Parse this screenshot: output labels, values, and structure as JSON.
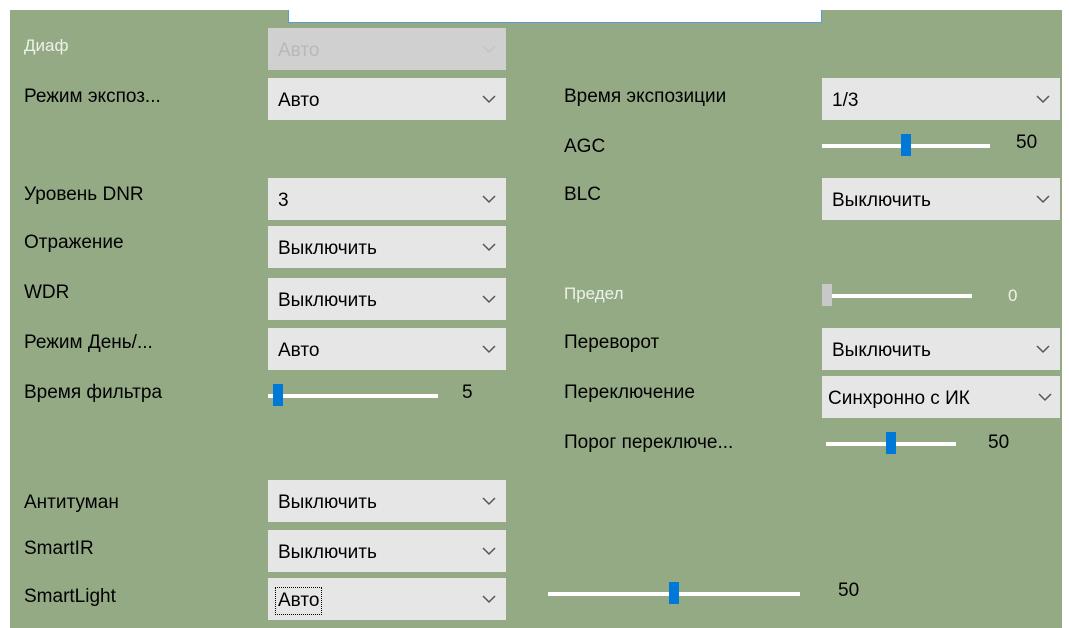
{
  "left": {
    "iris": {
      "label": "Диаф",
      "value": "Авто"
    },
    "exposure_mode": {
      "label": "Режим экспоз...",
      "value": "Авто"
    },
    "dnr_level": {
      "label": "Уровень DNR",
      "value": "3"
    },
    "mirror": {
      "label": "Отражение",
      "value": "Выключить"
    },
    "wdr": {
      "label": "WDR",
      "value": "Выключить"
    },
    "day_night": {
      "label": "Режим День/...",
      "value": "Авто"
    },
    "filter_time": {
      "label": "Время фильтра",
      "value": "5",
      "level": 0.03
    },
    "defog": {
      "label": "Антитуман",
      "value": "Выключить"
    },
    "smartir": {
      "label": "SmartIR",
      "value": "Выключить"
    },
    "smartlight": {
      "label": "SmartLight",
      "value": "Авто"
    },
    "smartlight_slider": {
      "value": "50",
      "level": 0.5
    }
  },
  "right": {
    "exposure_time": {
      "label": "Время экспозиции",
      "value": "1/3"
    },
    "agc": {
      "label": "AGC",
      "value": "50",
      "level": 0.5
    },
    "blc": {
      "label": "BLC",
      "value": "Выключить"
    },
    "limit": {
      "label": "Предел",
      "value": "0",
      "level": 0
    },
    "flip": {
      "label": "Переворот",
      "value": "Выключить"
    },
    "switch": {
      "label": "Переключение",
      "value": "Синхронно с ИК"
    },
    "switch_threshold": {
      "label": "Порог переключе...",
      "value": "50",
      "level": 0.5
    }
  },
  "colors": {
    "panel_bg": "#93aa85",
    "dropdown_bg": "#e6e6e6",
    "slider_thumb": "#0078d7",
    "slider_track": "#ffffff"
  },
  "icons": {
    "dropdown": "chevron-down-icon"
  }
}
